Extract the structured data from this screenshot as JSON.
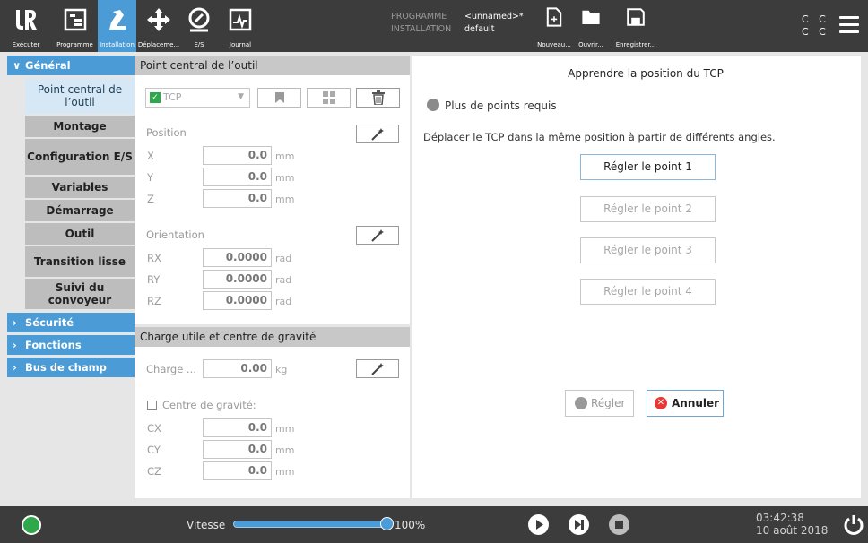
{
  "topbar": {
    "buttons": [
      {
        "id": "executer",
        "label": "Exécuter",
        "icon": "ur-logo-icon"
      },
      {
        "id": "programme",
        "label": "Programme",
        "icon": "program-icon"
      },
      {
        "id": "installation",
        "label": "Installation",
        "icon": "installation-icon",
        "active": true
      },
      {
        "id": "deplacement",
        "label": "Déplaceme...",
        "icon": "move-icon"
      },
      {
        "id": "es",
        "label": "E/S",
        "icon": "io-icon"
      },
      {
        "id": "journal",
        "label": "Journal",
        "icon": "log-icon"
      },
      {
        "id": "nouveau",
        "label": "Nouveau...",
        "icon": "new-file-icon"
      },
      {
        "id": "ouvrir",
        "label": "Ouvrir...",
        "icon": "folder-icon"
      },
      {
        "id": "enregistrer",
        "label": "Enregistrer...",
        "icon": "save-icon"
      }
    ],
    "programme_key": "PROGRAMME",
    "programme_val": "<unnamed>*",
    "installation_key": "INSTALLATION",
    "installation_val": "default",
    "cc_line1": "C C",
    "cc_line2": "C C"
  },
  "nav": {
    "general": "Général",
    "items": [
      "Point central de l’outil",
      "Montage",
      "Configuration E/S",
      "Variables",
      "Démarrage",
      "Outil",
      "Transition lisse",
      "Suivi du convoyeur"
    ],
    "securite": "Sécurité",
    "fonctions": "Fonctions",
    "bus": "Bus de champ"
  },
  "tcp": {
    "section_title": "Point central de l’outil",
    "select_value": "TCP",
    "position_label": "Position",
    "x_label": "X",
    "x_val": "0.0",
    "y_label": "Y",
    "y_val": "0.0",
    "z_label": "Z",
    "z_val": "0.0",
    "len_unit": "mm",
    "orientation_label": "Orientation",
    "rx_label": "RX",
    "rx_val": "0.0000",
    "ry_label": "RY",
    "ry_val": "0.0000",
    "rz_label": "RZ",
    "rz_val": "0.0000",
    "rad_unit": "rad"
  },
  "payload": {
    "section_title": "Charge utile et centre de gravité",
    "charge_label": "Charge ...",
    "charge_val": "0.00",
    "charge_unit": "kg",
    "cog_label": "Centre de gravité:",
    "cx_label": "CX",
    "cx_val": "0.0",
    "cy_label": "CY",
    "cy_val": "0.0",
    "cz_label": "CZ",
    "cz_val": "0.0",
    "unit": "mm"
  },
  "teach": {
    "title": "Apprendre la position du TCP",
    "status": "Plus de points requis",
    "instruction": "Déplacer le TCP dans la même position à partir de différents angles.",
    "points": [
      "Régler le point 1",
      "Régler le point 2",
      "Régler le point 3",
      "Régler le point 4"
    ],
    "set_label": "Régler",
    "cancel_label": "Annuler"
  },
  "bottombar": {
    "speed_label": "Vitesse",
    "speed_value": "100%",
    "speed_fraction": 1.0,
    "time": "03:42:38",
    "date": "10 août 2018"
  },
  "colors": {
    "accent": "#4a9bd6",
    "bar": "#3c3c3c",
    "power_on": "#2ea84a",
    "cancel_red": "#e53935"
  }
}
